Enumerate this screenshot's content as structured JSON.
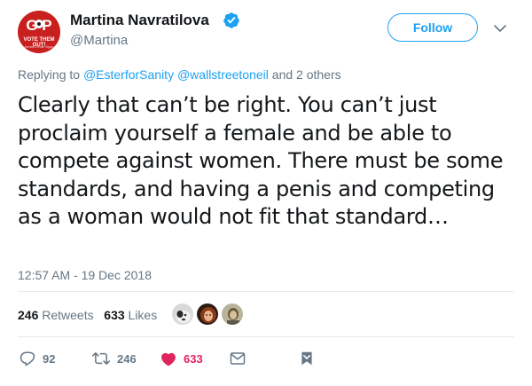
{
  "author": {
    "display_name": "Martina Navratilova",
    "handle": "@Martina",
    "avatar": {
      "logo_text": "G P",
      "slogan": "VOTE THEM OUT!",
      "subtext": "#resist #vote #gop"
    }
  },
  "follow_label": "Follow",
  "reply_context": {
    "prefix": "Replying to ",
    "user1": "@EsterforSanity",
    "user2": "@wallstreetoneil",
    "suffix": " and 2 others"
  },
  "tweet_text": "Clearly that can’t be right. You can’t just proclaim yourself a female and be able to compete against women. There must be some standards, and having a penis and competing as a woman would not fit that standard…",
  "timestamp": "12:57 AM - 19 Dec 2018",
  "stats": {
    "retweets_count": "246",
    "retweets_label": "Retweets",
    "likes_count": "633",
    "likes_label": "Likes"
  },
  "actions": {
    "reply_count": "92",
    "retweet_count": "246",
    "like_count": "633"
  },
  "colors": {
    "accent": "#1da1f2",
    "like": "#e0245e",
    "muted": "#657786",
    "avatar_bg": "#c8201e"
  },
  "icons": [
    "verified-badge-icon",
    "chevron-down-icon",
    "reply-icon",
    "retweet-icon",
    "heart-icon",
    "envelope-icon",
    "bookmark-icon"
  ]
}
